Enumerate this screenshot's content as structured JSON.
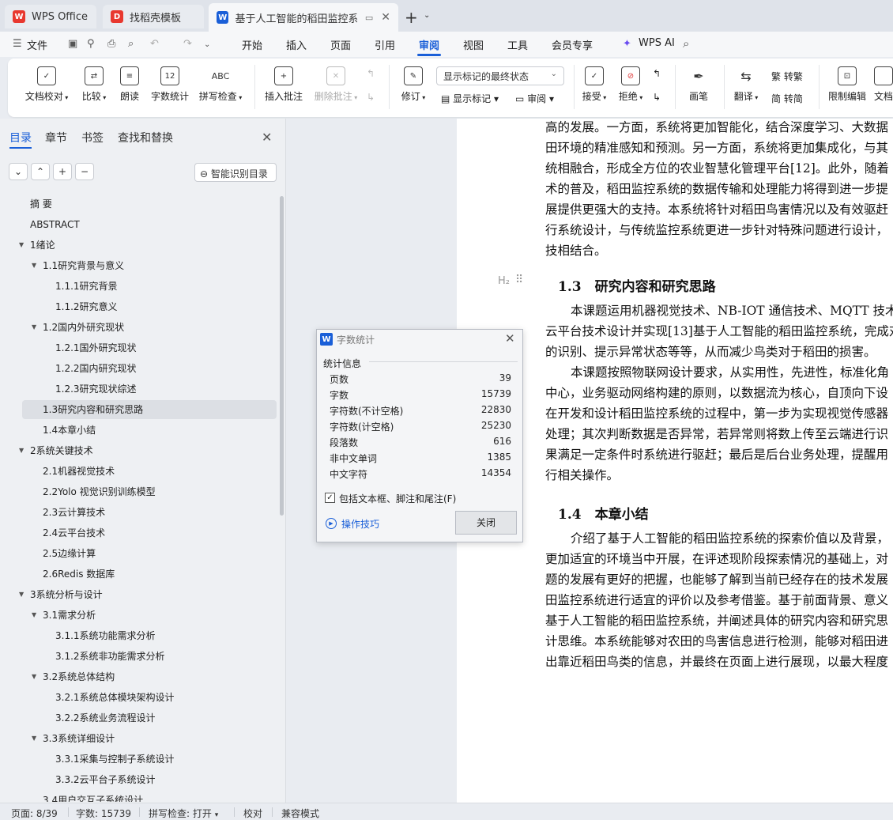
{
  "tabs": [
    {
      "label": "WPS Office",
      "icon": "wps-logo-icon",
      "color": "#e8382f"
    },
    {
      "label": "找稻壳模板",
      "icon": "docer-icon",
      "color": "#e8382f"
    },
    {
      "label": "基于人工智能的稻田监控系统",
      "icon": "word-doc-icon",
      "color": "#1a5fd8"
    }
  ],
  "menu": {
    "file": "文件",
    "items": [
      "开始",
      "插入",
      "页面",
      "引用",
      "审阅",
      "视图",
      "工具",
      "会员专享"
    ],
    "active": "审阅",
    "ai": "WPS AI"
  },
  "ribbon": {
    "doc_check": "文档校对",
    "compare": "比较",
    "read_aloud": "朗读",
    "word_count": "字数统计",
    "spell_check": "拼写检查",
    "insert_comment": "插入批注",
    "delete_comment": "删除批注",
    "revise": "修订",
    "show_markup": "显示标记",
    "review": "审阅",
    "markup_select": "显示标记的最终状态",
    "accept": "接受",
    "reject": "拒绝",
    "ink": "画笔",
    "translate": "翻译",
    "to_traditional": "转繁",
    "to_simplified": "转简",
    "restrict_edit": "限制编辑",
    "doc_more": "文档",
    "word_count_icon_text": "12",
    "spell_icon_text": "ABC",
    "trad_icon_text": "繁",
    "simp_icon_text": "简"
  },
  "nav": {
    "tabs": [
      "目录",
      "章节",
      "书签",
      "查找和替换"
    ],
    "smart_toc": "智能识别目录",
    "items": [
      {
        "label": "摘 要",
        "level": 0,
        "arrow": false
      },
      {
        "label": "ABSTRACT",
        "level": 0,
        "arrow": false
      },
      {
        "label": "1绪论",
        "level": 0,
        "arrow": true
      },
      {
        "label": "1.1研究背景与意义",
        "level": 1,
        "arrow": true
      },
      {
        "label": "1.1.1研究背景",
        "level": 2,
        "arrow": false
      },
      {
        "label": "1.1.2研究意义",
        "level": 2,
        "arrow": false
      },
      {
        "label": "1.2国内外研究现状",
        "level": 1,
        "arrow": true
      },
      {
        "label": "1.2.1国外研究现状",
        "level": 2,
        "arrow": false
      },
      {
        "label": "1.2.2国内研究现状",
        "level": 2,
        "arrow": false
      },
      {
        "label": "1.2.3研究现状综述",
        "level": 2,
        "arrow": false
      },
      {
        "label": "1.3研究内容和研究思路",
        "level": 1,
        "arrow": false,
        "selected": true
      },
      {
        "label": "1.4本章小结",
        "level": 1,
        "arrow": false
      },
      {
        "label": "2系统关键技术",
        "level": 0,
        "arrow": true
      },
      {
        "label": "2.1机器视觉技术",
        "level": 1,
        "arrow": false
      },
      {
        "label": "2.2Yolo 视觉识别训练模型",
        "level": 1,
        "arrow": false
      },
      {
        "label": "2.3云计算技术",
        "level": 1,
        "arrow": false
      },
      {
        "label": "2.4云平台技术",
        "level": 1,
        "arrow": false
      },
      {
        "label": "2.5边缘计算",
        "level": 1,
        "arrow": false
      },
      {
        "label": "2.6Redis 数据库",
        "level": 1,
        "arrow": false
      },
      {
        "label": "3系统分析与设计",
        "level": 0,
        "arrow": true
      },
      {
        "label": "3.1需求分析",
        "level": 1,
        "arrow": true
      },
      {
        "label": "3.1.1系统功能需求分析",
        "level": 2,
        "arrow": false
      },
      {
        "label": "3.1.2系统非功能需求分析",
        "level": 2,
        "arrow": false
      },
      {
        "label": "3.2系统总体结构",
        "level": 1,
        "arrow": true
      },
      {
        "label": "3.2.1系统总体模块架构设计",
        "level": 2,
        "arrow": false
      },
      {
        "label": "3.2.2系统业务流程设计",
        "level": 2,
        "arrow": false
      },
      {
        "label": "3.3系统详细设计",
        "level": 1,
        "arrow": true
      },
      {
        "label": "3.3.1采集与控制子系统设计",
        "level": 2,
        "arrow": false
      },
      {
        "label": "3.3.2云平台子系统设计",
        "level": 2,
        "arrow": false
      },
      {
        "label": "3.4用户交互子系统设计",
        "level": 1,
        "arrow": false
      }
    ]
  },
  "doc": {
    "para1": [
      "高的发展。一方面，系统将更加智能化，结合深度学习、大数据",
      "田环境的精准感知和预测。另一方面，系统将更加集成化，与其",
      "统相融合，形成全方位的农业智慧化管理平台[12]。此外，随着",
      "术的普及，稻田监控系统的数据传输和处理能力将得到进一步提",
      "展提供更强大的支持。本系统将针对稻田鸟害情况以及有效驱赶",
      "行系统设计，与传统监控系统更进一步针对特殊问题进行设计，",
      "技相结合。"
    ],
    "h2_mark": "H₂",
    "heading13": "1.3　研究内容和研究思路",
    "para2": [
      "本课题运用机器视觉技术、NB-IOT 通信技术、MQTT 技术",
      "云平台技术设计并实现[13]基于人工智能的稻田监控系统，完成对",
      "的识别、提示异常状态等等，从而减少鸟类对于稻田的损害。",
      "本课题按照物联网设计要求，从实用性，先进性，标准化角",
      "中心，业务驱动网络构建的原则，以数据流为核心，自顶向下设",
      "在开发和设计稻田监控系统的过程中，第一步为实现视觉传感器",
      "处理；其次判断数据是否异常，若异常则将数上传至云端进行识",
      "果满足一定条件时系统进行驱赶；最后是后台业务处理，提醒用",
      "行相关操作。"
    ],
    "heading14": "1.4　本章小结",
    "para3": [
      "介绍了基于人工智能的稻田监控系统的探索价值以及背景，",
      "更加适宜的环境当中开展，在评述现阶段探索情况的基础上，对",
      "题的发展有更好的把握，也能够了解到当前已经存在的技术发展",
      "田监控系统进行适宜的评价以及参考借鉴。基于前面背景、意义",
      "基于人工智能的稻田监控系统，并阐述具体的研究内容和研究思",
      "计思维。本系统能够对农田的鸟害信息进行检测，能够对稻田进",
      "出靠近稻田鸟类的信息，并最终在页面上进行展现，以最大程度"
    ]
  },
  "dialog": {
    "title": "字数统计",
    "section": "统计信息",
    "stats": [
      {
        "label": "页数",
        "value": "39"
      },
      {
        "label": "字数",
        "value": "15739"
      },
      {
        "label": "字符数(不计空格)",
        "value": "22830"
      },
      {
        "label": "字符数(计空格)",
        "value": "25230"
      },
      {
        "label": "段落数",
        "value": "616"
      },
      {
        "label": "非中文单词",
        "value": "1385"
      },
      {
        "label": "中文字符",
        "value": "14354"
      }
    ],
    "checkbox_label": "包括文本框、脚注和尾注(F)",
    "checkbox_checked": true,
    "tips": "操作技巧",
    "close_btn": "关闭"
  },
  "status": {
    "page": "页面: 8/39",
    "words": "字数: 15739",
    "spell": "拼写检查: 打开",
    "proof": "校对",
    "compat": "兼容模式"
  },
  "colors": {
    "accent": "#1a5fd8",
    "wps_red": "#e8382f"
  }
}
